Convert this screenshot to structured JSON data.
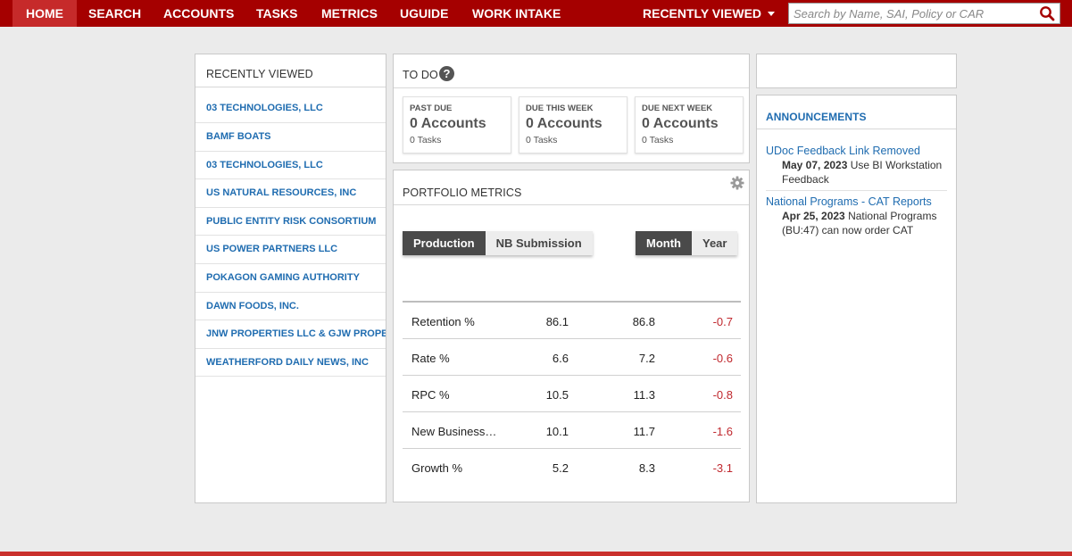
{
  "nav": {
    "items": [
      {
        "label": "HOME",
        "active": true
      },
      {
        "label": "SEARCH",
        "active": false
      },
      {
        "label": "ACCOUNTS",
        "active": false
      },
      {
        "label": "TASKS",
        "active": false
      },
      {
        "label": "METRICS",
        "active": false
      },
      {
        "label": "UGUIDE",
        "active": false
      },
      {
        "label": "WORK INTAKE",
        "active": false
      }
    ],
    "recently_viewed_label": "RECENTLY VIEWED",
    "search_placeholder": "Search by Name, SAI, Policy or CAR"
  },
  "recently_viewed": {
    "title": "RECENTLY VIEWED",
    "items": [
      "03 TECHNOLOGIES, LLC",
      "BAMF BOATS",
      "03 TECHNOLOGIES, LLC",
      "US NATURAL RESOURCES, INC",
      "PUBLIC ENTITY RISK CONSORTIUM",
      "US POWER PARTNERS LLC",
      "POKAGON GAMING AUTHORITY",
      "DAWN FOODS, INC.",
      "JNW PROPERTIES LLC & GJW PROPE",
      "WEATHERFORD DAILY NEWS, INC"
    ]
  },
  "todo": {
    "title": "TO DO",
    "help_icon": "?",
    "cards": [
      {
        "label": "PAST DUE",
        "accounts": "0 Accounts",
        "tasks": "0 Tasks"
      },
      {
        "label": "DUE THIS WEEK",
        "accounts": "0 Accounts",
        "tasks": "0 Tasks"
      },
      {
        "label": "DUE NEXT WEEK",
        "accounts": "0 Accounts",
        "tasks": "0 Tasks"
      }
    ]
  },
  "portfolio_metrics": {
    "title": "PORTFOLIO METRICS",
    "type_toggle": {
      "options": [
        "Production",
        "NB Submission"
      ],
      "selected": "Production"
    },
    "period_toggle": {
      "options": [
        "Month",
        "Year"
      ],
      "selected": "Month"
    },
    "rows": [
      {
        "name": "Retention %",
        "current": "86.1",
        "prior": "86.8",
        "diff": "-0.7"
      },
      {
        "name": "Rate %",
        "current": "6.6",
        "prior": "7.2",
        "diff": "-0.6"
      },
      {
        "name": "RPC %",
        "current": "10.5",
        "prior": "11.3",
        "diff": "-0.8"
      },
      {
        "name": "New Business…",
        "current": "10.1",
        "prior": "11.7",
        "diff": "-1.6"
      },
      {
        "name": "Growth %",
        "current": "5.2",
        "prior": "8.3",
        "diff": "-3.1"
      }
    ]
  },
  "announcements": {
    "title": "ANNOUNCEMENTS",
    "items": [
      {
        "title": "UDoc Feedback Link Removed",
        "date": "May 07, 2023",
        "body": "Use BI Workstation Feedback"
      },
      {
        "title": "National Programs - CAT Reports",
        "date": "Apr 25, 2023",
        "body": "National Programs (BU:47) can now order CAT"
      }
    ]
  },
  "colors": {
    "brand_red": "#a50000",
    "active_tab": "#c62a2a",
    "link_blue": "#1f6cb0",
    "negative_red": "#c0282e"
  }
}
